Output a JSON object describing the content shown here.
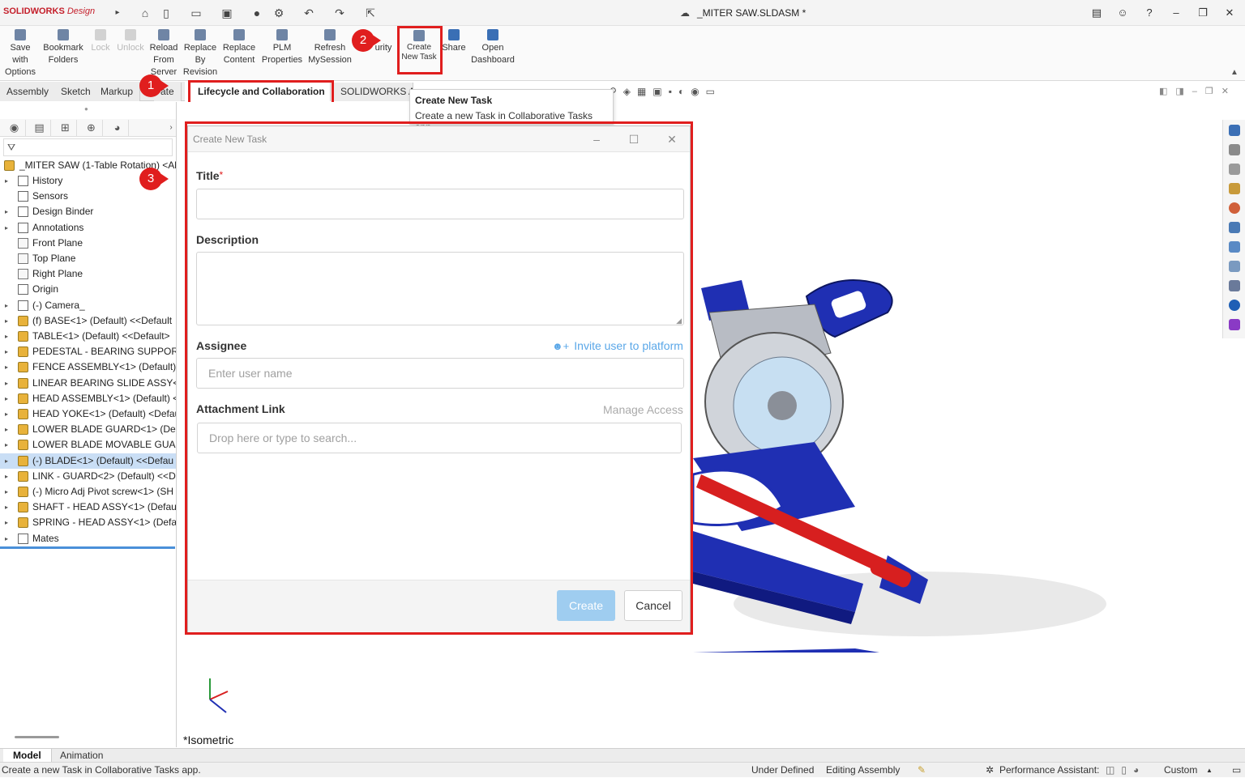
{
  "app": {
    "brand": "SOLIDWORKS",
    "brand_suffix": "Design",
    "doc_title": "_MITER SAW.SLDASM *"
  },
  "ribbon": {
    "buttons": [
      {
        "label": "Save with Options",
        "enabled": true
      },
      {
        "label": "Bookmark Folders",
        "enabled": true
      },
      {
        "label": "Lock",
        "enabled": false
      },
      {
        "label": "Unlock",
        "enabled": false
      },
      {
        "label": "Reload From Server",
        "enabled": true
      },
      {
        "label": "Replace By Revision",
        "enabled": true
      },
      {
        "label": "Replace Content",
        "enabled": true
      },
      {
        "label": "PLM Properties",
        "enabled": true
      },
      {
        "label": "Refresh MySession",
        "enabled": true
      },
      {
        "label": "urity",
        "enabled": true
      },
      {
        "label": "Create New Task",
        "enabled": true
      },
      {
        "label": "Share",
        "enabled": true
      },
      {
        "label": "Open Dashboard",
        "enabled": true
      }
    ]
  },
  "command_tabs": [
    "Assembly",
    "Sketch",
    "Markup",
    "ate",
    "Lifecycle and Collaboration",
    "SOLIDWORKS A"
  ],
  "active_tab": "Lifecycle and Collaboration",
  "steps": [
    "1",
    "2",
    "3"
  ],
  "tooltip": {
    "title": "Create New Task",
    "text": "Create a new Task in Collaborative Tasks app."
  },
  "tree": {
    "root": "_MITER SAW (1-Table Rotation) <All",
    "items": [
      {
        "label": "History",
        "icon": "history-icon",
        "expand": true
      },
      {
        "label": "Sensors",
        "icon": "sensor-icon",
        "expand": false
      },
      {
        "label": "Design Binder",
        "icon": "binder-icon",
        "expand": true
      },
      {
        "label": "Annotations",
        "icon": "annotation-icon",
        "expand": true
      },
      {
        "label": "Front Plane",
        "icon": "plane-icon",
        "expand": false
      },
      {
        "label": "Top Plane",
        "icon": "plane-icon",
        "expand": false
      },
      {
        "label": "Right Plane",
        "icon": "plane-icon",
        "expand": false
      },
      {
        "label": "Origin",
        "icon": "origin-icon",
        "expand": false
      },
      {
        "label": "(-) Camera_",
        "icon": "folder-icon",
        "expand": true
      },
      {
        "label": "(f) BASE<1> (Default) <<Default",
        "icon": "assembly-icon",
        "expand": true
      },
      {
        "label": "TABLE<1> (Default) <<Default>",
        "icon": "assembly-icon",
        "expand": true
      },
      {
        "label": "PEDESTAL - BEARING SUPPORT<",
        "icon": "assembly-icon",
        "expand": true
      },
      {
        "label": "FENCE ASSEMBLY<1> (Default) <",
        "icon": "assembly-icon",
        "expand": true
      },
      {
        "label": "LINEAR BEARING SLIDE ASSY<1>",
        "icon": "assembly-icon",
        "expand": true
      },
      {
        "label": "HEAD ASSEMBLY<1> (Default) <",
        "icon": "assembly-icon",
        "expand": true
      },
      {
        "label": "HEAD YOKE<1> (Default) <Defau",
        "icon": "assembly-icon",
        "expand": true
      },
      {
        "label": "LOWER BLADE GUARD<1> (Defa",
        "icon": "assembly-icon",
        "expand": true
      },
      {
        "label": "LOWER BLADE MOVABLE GUARD",
        "icon": "assembly-icon",
        "expand": true
      },
      {
        "label": "(-) BLADE<1> (Default) <<Defau",
        "icon": "assembly-icon",
        "expand": true,
        "selected": true
      },
      {
        "label": "LINK - GUARD<2> (Default) <<D",
        "icon": "assembly-icon",
        "expand": true
      },
      {
        "label": "(-) Micro Adj Pivot screw<1> (SH",
        "icon": "part-icon",
        "expand": true
      },
      {
        "label": "SHAFT - HEAD ASSY<1> (Default",
        "icon": "assembly-icon",
        "expand": true
      },
      {
        "label": "SPRING - HEAD ASSY<1> (Defau",
        "icon": "assembly-icon",
        "expand": true
      },
      {
        "label": "Mates",
        "icon": "mates-icon",
        "expand": true
      }
    ]
  },
  "dialog": {
    "title": "Create New Task",
    "title_label": "Title",
    "required_mark": "*",
    "description_label": "Description",
    "assignee_label": "Assignee",
    "invite_link": "Invite user to platform",
    "assignee_placeholder": "Enter user name",
    "attachment_label": "Attachment Link",
    "manage_access": "Manage Access",
    "attachment_placeholder": "Drop here or type to search...",
    "create_label": "Create",
    "cancel_label": "Cancel"
  },
  "viewport": {
    "view_label": "*Isometric"
  },
  "bottom_tabs": [
    "Model",
    "Animation"
  ],
  "status": {
    "message": "Create a new Task in Collaborative Tasks app.",
    "state": "Under Defined",
    "mode": "Editing Assembly",
    "assistant": "Performance Assistant:",
    "units": "Custom"
  },
  "colors": {
    "highlight": "#e01e1e",
    "accent": "#5aa7e8",
    "model_blue": "#1f2fb3"
  }
}
